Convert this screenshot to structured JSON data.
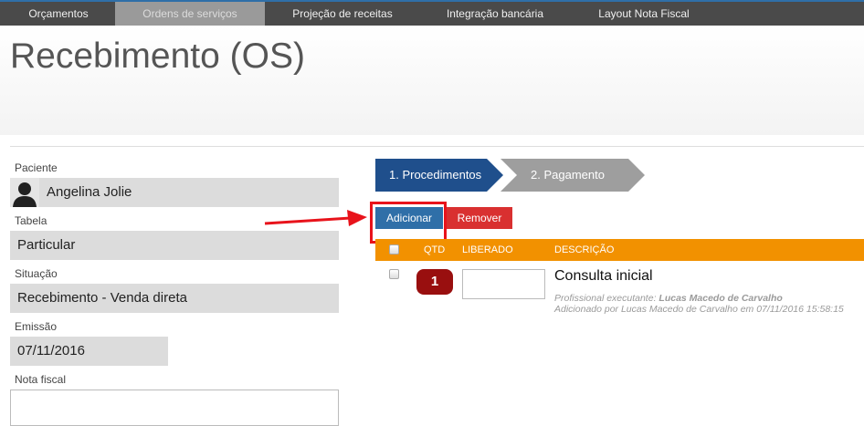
{
  "nav": {
    "tabs": [
      {
        "label": "Orçamentos"
      },
      {
        "label": "Ordens de serviços"
      },
      {
        "label": "Projeção de receitas"
      },
      {
        "label": "Integração bancária"
      },
      {
        "label": "Layout Nota Fiscal"
      }
    ],
    "active_index": 1
  },
  "page": {
    "title": "Recebimento (OS)"
  },
  "form": {
    "paciente": {
      "label": "Paciente",
      "value": "Angelina Jolie"
    },
    "tabela": {
      "label": "Tabela",
      "value": "Particular"
    },
    "situacao": {
      "label": "Situação",
      "value": "Recebimento - Venda direta"
    },
    "emissao": {
      "label": "Emissão",
      "value": "07/11/2016"
    },
    "nota_fiscal": {
      "label": "Nota fiscal",
      "value": ""
    }
  },
  "wizard": {
    "steps": [
      {
        "label": "1. Procedimentos",
        "active": true
      },
      {
        "label": "2. Pagamento",
        "active": false
      }
    ]
  },
  "actions": {
    "add_label": "Adicionar",
    "remove_label": "Remover"
  },
  "table": {
    "headers": {
      "qtd": "QTD",
      "liberado": "LIBERADO",
      "descricao": "DESCRIÇÃO"
    },
    "rows": [
      {
        "qtd": "1",
        "liberado": "",
        "descricao": "Consulta inicial",
        "prof_prefix": "Profissional executante:",
        "prof_name": "Lucas Macedo de Carvalho",
        "added": "Adicionado por Lucas Macedo de Carvalho em 07/11/2016 15:58:15"
      }
    ]
  },
  "colors": {
    "nav_bg": "#4a4a4a",
    "step_active": "#1f4f8c",
    "step_inactive": "#9e9e9e",
    "add_button": "#2f6fa8",
    "remove_button": "#d93030",
    "table_header": "#f29100",
    "qty_badge": "#990f0f",
    "highlight": "#e8131b"
  }
}
